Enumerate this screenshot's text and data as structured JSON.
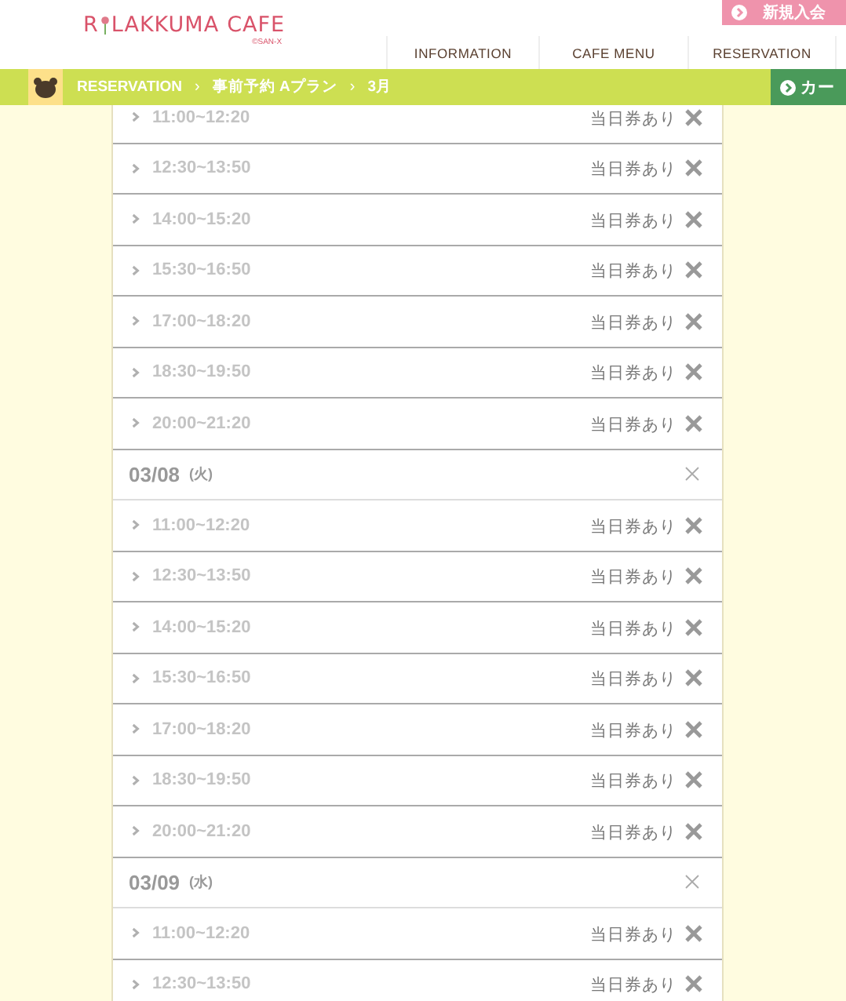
{
  "header": {
    "logo": {
      "first": "R",
      "middle": "LAKKUMA",
      "last": "CAFE",
      "copyright": "©SAN-X"
    },
    "join_button": "新規入会",
    "nav": [
      {
        "label": "INFORMATION",
        "selected": false
      },
      {
        "label": "CAFE MENU",
        "selected": false
      },
      {
        "label": "RESERVATION",
        "selected": false
      }
    ]
  },
  "breadcrumb": {
    "items": [
      "RESERVATION",
      "事前予約 Aプラン",
      "3月"
    ],
    "separator": "›",
    "cart_button": "カー"
  },
  "days": [
    {
      "slots": [
        {
          "time": "11:00~12:20",
          "status": "当日券あり"
        },
        {
          "time": "12:30~13:50",
          "status": "当日券あり"
        },
        {
          "time": "14:00~15:20",
          "status": "当日券あり"
        },
        {
          "time": "15:30~16:50",
          "status": "当日券あり"
        },
        {
          "time": "17:00~18:20",
          "status": "当日券あり"
        },
        {
          "time": "18:30~19:50",
          "status": "当日券あり"
        },
        {
          "time": "20:00~21:20",
          "status": "当日券あり"
        }
      ]
    },
    {
      "date": "03/08",
      "weekday": "(火)",
      "slots": [
        {
          "time": "11:00~12:20",
          "status": "当日券あり"
        },
        {
          "time": "12:30~13:50",
          "status": "当日券あり"
        },
        {
          "time": "14:00~15:20",
          "status": "当日券あり"
        },
        {
          "time": "15:30~16:50",
          "status": "当日券あり"
        },
        {
          "time": "17:00~18:20",
          "status": "当日券あり"
        },
        {
          "time": "18:30~19:50",
          "status": "当日券あり"
        },
        {
          "time": "20:00~21:20",
          "status": "当日券あり"
        }
      ]
    },
    {
      "date": "03/09",
      "weekday": "(水)",
      "slots": [
        {
          "time": "11:00~12:20",
          "status": "当日券あり"
        },
        {
          "time": "12:30~13:50",
          "status": "当日券あり"
        }
      ]
    }
  ]
}
